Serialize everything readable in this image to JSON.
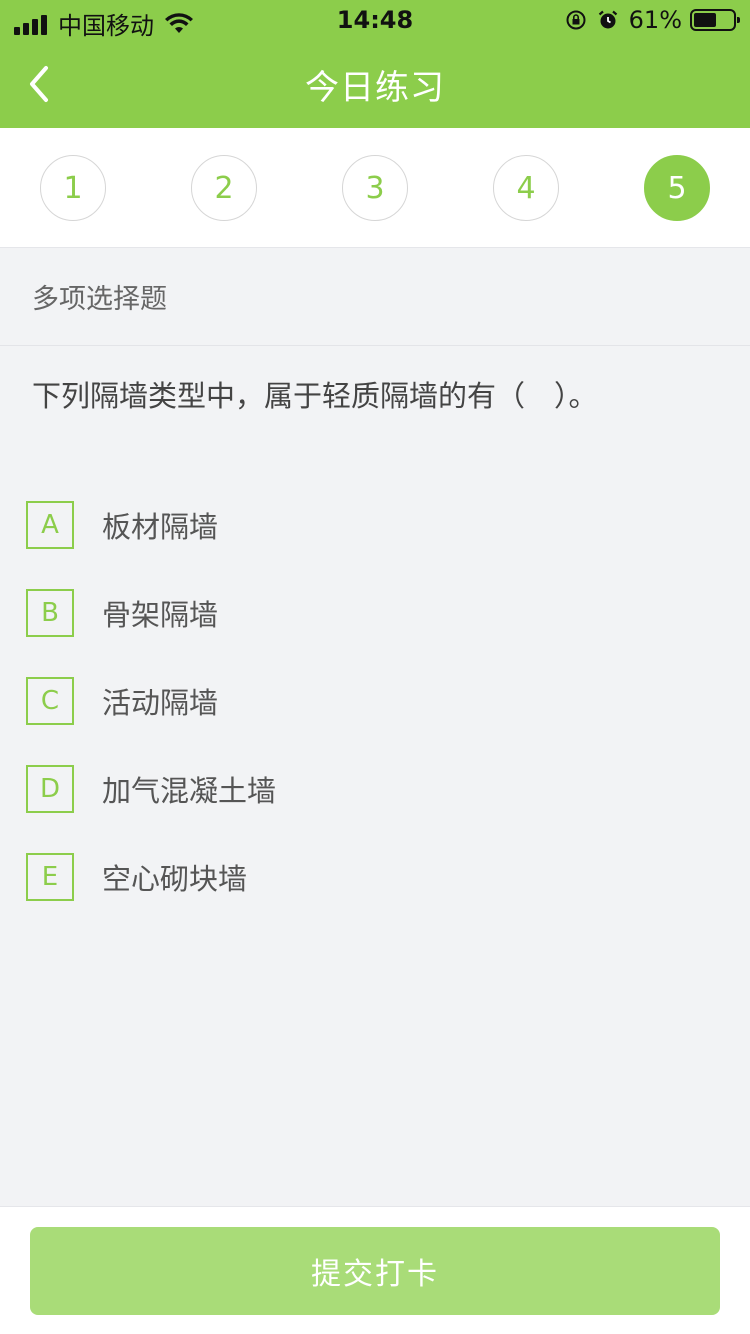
{
  "status_bar": {
    "carrier": "中国移动",
    "time": "14:48",
    "battery": "61%",
    "battery_level": 0.61
  },
  "header": {
    "title": "今日练习",
    "accent_color": "#8ccd4b"
  },
  "steps": [
    {
      "label": "1",
      "active": false
    },
    {
      "label": "2",
      "active": false
    },
    {
      "label": "3",
      "active": false
    },
    {
      "label": "4",
      "active": false
    },
    {
      "label": "5",
      "active": true
    }
  ],
  "question": {
    "type": "多项选择题",
    "text": "下列隔墙类型中，属于轻质隔墙的有（　）。",
    "options": [
      {
        "key": "A",
        "text": "板材隔墙"
      },
      {
        "key": "B",
        "text": "骨架隔墙"
      },
      {
        "key": "C",
        "text": "活动隔墙"
      },
      {
        "key": "D",
        "text": "加气混凝土墙"
      },
      {
        "key": "E",
        "text": "空心砌块墙"
      }
    ]
  },
  "footer": {
    "submit_label": "提交打卡"
  }
}
